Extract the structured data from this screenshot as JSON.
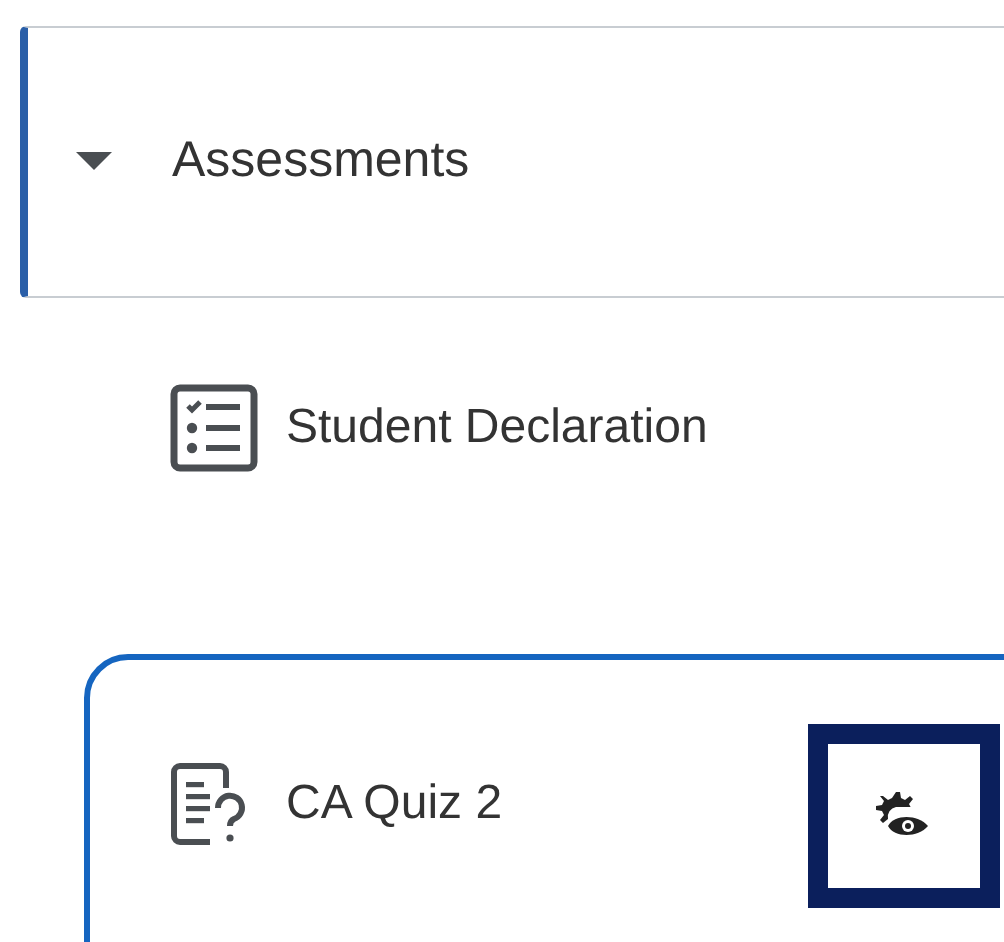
{
  "section": {
    "title": "Assessments",
    "expanded": true
  },
  "items": [
    {
      "label": "Student Declaration",
      "kind": "checklist",
      "selected": false
    },
    {
      "label": "CA Quiz 2",
      "kind": "quiz",
      "selected": true
    }
  ]
}
